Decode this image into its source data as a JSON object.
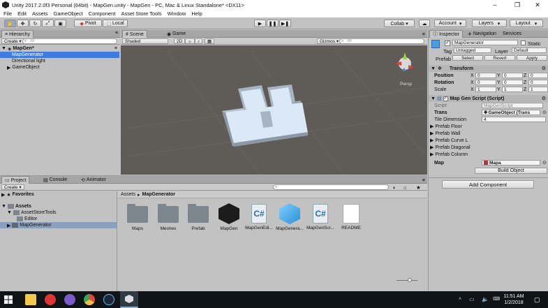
{
  "window": {
    "title": "Unity 2017.2.0f3 Personal (64bit) - MapGen.unity - MapGen - PC, Mac & Linux Standalone* <DX11>",
    "minimize": "–",
    "maximize": "❐",
    "close": "✕"
  },
  "menu": [
    "File",
    "Edit",
    "Assets",
    "GameObject",
    "Component",
    "Asset Store Tools",
    "Window",
    "Help"
  ],
  "toolbar": {
    "pivot": "Pivot",
    "local": "Local",
    "collab": "Collab ▾",
    "account": "Account",
    "layers": "Layers",
    "layout": "Layout"
  },
  "hierarchy": {
    "tab": "Hierarchy",
    "create": "Create ▾",
    "search_placeholder": "All",
    "scene": "MapGen*",
    "items": [
      "MapGenerator",
      "Directional light",
      "GameObject"
    ]
  },
  "scene_view": {
    "tabs": [
      "Scene",
      "Game"
    ],
    "shading": "Shaded",
    "mode_2d": "2D",
    "gizmos": "Gizmos ▾",
    "search_placeholder": "All",
    "persp": "Persp"
  },
  "inspector": {
    "tabs": [
      "Inspector",
      "Navigation",
      "Services"
    ],
    "object_name": "MapGenerator",
    "static_label": "Static",
    "tag_label": "Tag",
    "tag_value": "Untagged",
    "layer_label": "Layer",
    "layer_value": "Default",
    "prefab_label": "Prefab",
    "prefab_select": "Select",
    "prefab_revert": "Revert",
    "prefab_apply": "Apply",
    "transform": {
      "title": "Transform",
      "rows": [
        {
          "label": "Position",
          "x": "0",
          "y": "0",
          "z": "0"
        },
        {
          "label": "Rotation",
          "x": "0",
          "y": "0",
          "z": "0"
        },
        {
          "label": "Scale",
          "x": "1",
          "y": "1",
          "z": "1"
        }
      ]
    },
    "script_component": {
      "title": "Map Gen Script (Script)",
      "script_label": "Script",
      "script_value": "MapGenScript",
      "trans_label": "Trans",
      "trans_value": "GameObject (Trans",
      "tile_label": "Tile Dimension",
      "tile_value": "4",
      "foldouts": [
        "Prefab Floor",
        "Prefab Wall",
        "Prefab Curve L",
        "Prefab Diagonal",
        "Prefab Column"
      ],
      "map_label": "Map",
      "map_value": "Mapa",
      "build_button": "Build Object"
    },
    "add_component": "Add Component"
  },
  "project": {
    "tabs": [
      "Project",
      "Console",
      "Animator"
    ],
    "create": "Create ▾",
    "favorites": "Favorites",
    "tree": [
      "Assets",
      "AssetStoreTools",
      "Editor",
      "MapGenerator"
    ],
    "breadcrumb": [
      "Assets",
      "MapGenerator"
    ],
    "assets": [
      {
        "name": "Maps",
        "kind": "folder"
      },
      {
        "name": "Meshes",
        "kind": "folder"
      },
      {
        "name": "Prefab",
        "kind": "folder"
      },
      {
        "name": "MapGen",
        "kind": "unity"
      },
      {
        "name": "MapGenEdi...",
        "kind": "script"
      },
      {
        "name": "MapGenera...",
        "kind": "prefab"
      },
      {
        "name": "MapGenScr...",
        "kind": "script"
      },
      {
        "name": "README",
        "kind": "doc"
      }
    ]
  },
  "taskbar": {
    "time": "11:51 AM",
    "date": "1/2/2018"
  },
  "colors": {
    "accent_blue": "#3e7ce0",
    "scene_bg": "#5f5b57",
    "panel_bg": "#c2c2c2"
  }
}
